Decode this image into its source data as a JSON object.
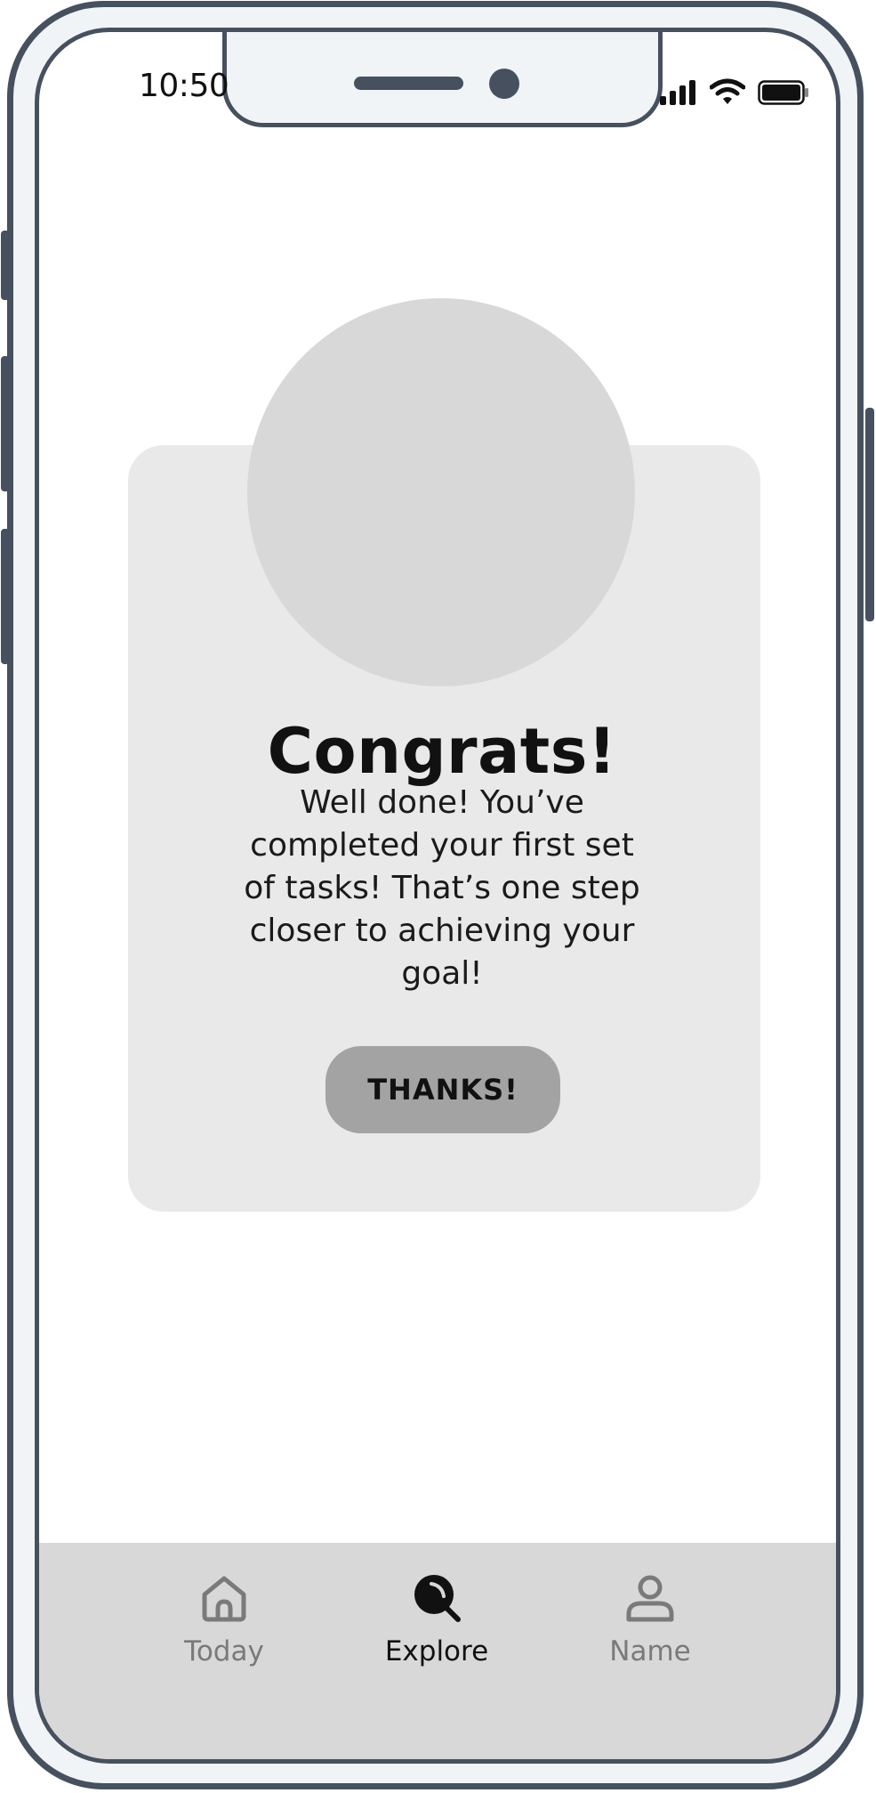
{
  "status_bar": {
    "time": "10:50"
  },
  "dialog": {
    "title": "Congrats!",
    "message": "Well done! You’ve completed your first set of tasks! That’s one step closer to achieving your goal!",
    "button_label": "THANKS!"
  },
  "tabbar": {
    "items": [
      {
        "label": "Today",
        "icon": "home-icon",
        "active": false
      },
      {
        "label": "Explore",
        "icon": "search-icon",
        "active": true
      },
      {
        "label": "Name",
        "icon": "user-icon",
        "active": false
      }
    ]
  },
  "colors": {
    "frame": "#46505f",
    "card": "#e9e9e9",
    "placeholder": "#d8d8d8",
    "button": "#a3a3a3",
    "tabbar": "#d8d8d8"
  }
}
